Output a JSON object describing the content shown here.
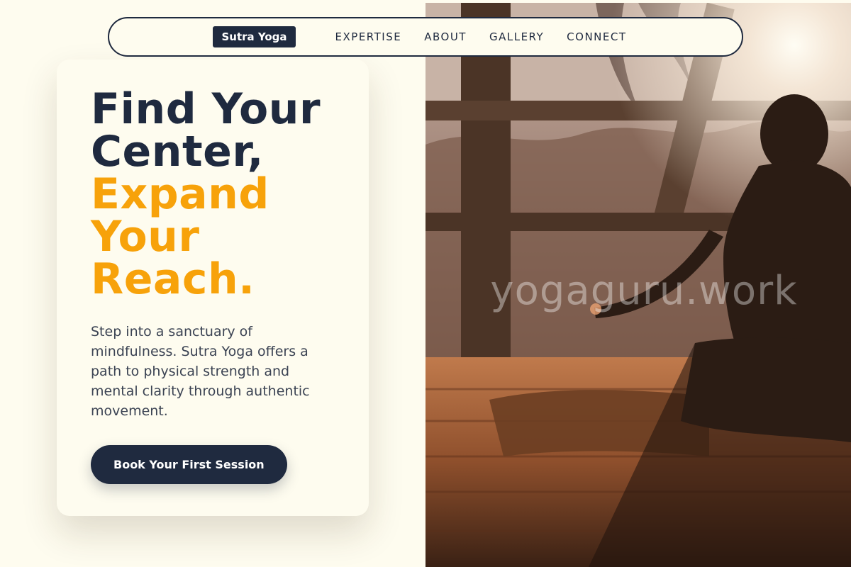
{
  "nav": {
    "brand": "Sutra Yoga",
    "links": [
      "EXPERTISE",
      "ABOUT",
      "GALLERY",
      "CONNECT"
    ]
  },
  "hero": {
    "headline_dark": [
      "Find Your",
      "Center,"
    ],
    "headline_accent": [
      "Expand",
      "Your",
      "Reach."
    ],
    "description": "Step into a sanctuary of mindfulness. Sutra Yoga offers a path to physical strength and mental clarity through authentic movement.",
    "cta_label": "Book Your First Session"
  },
  "photo": {
    "watermark": "yogaguru.work"
  },
  "colors": {
    "background": "#fefcef",
    "navy": "#1f2a3f",
    "accent": "#f7a20a",
    "body_text": "#3b4353"
  }
}
